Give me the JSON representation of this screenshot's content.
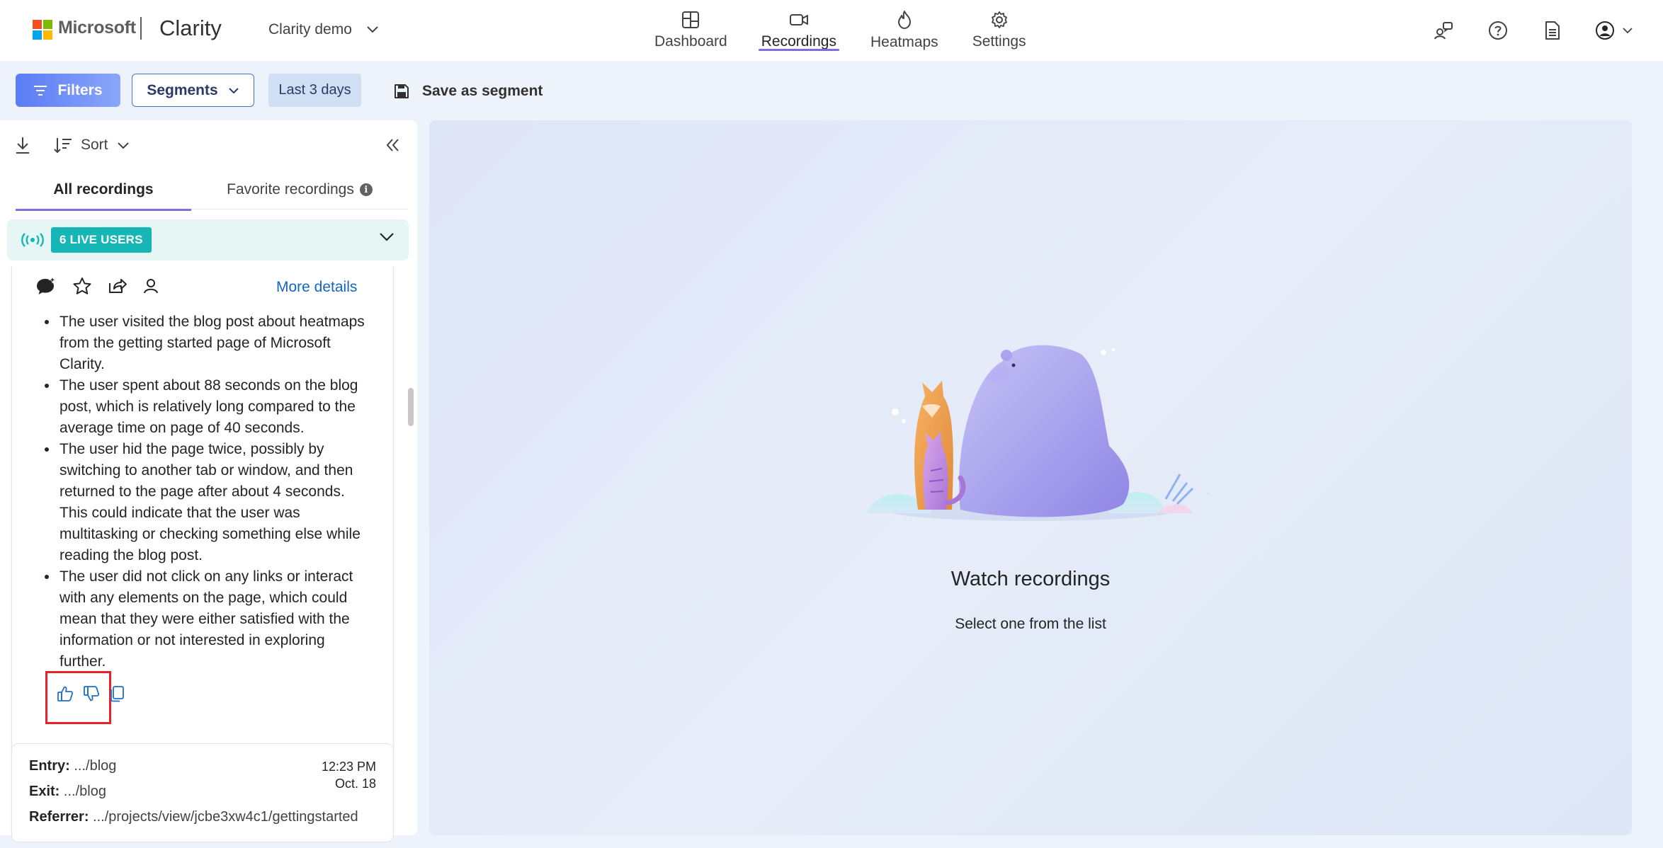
{
  "header": {
    "brand": "Microsoft",
    "app_name": "Clarity",
    "project": "Clarity demo",
    "nav": [
      {
        "label": "Dashboard",
        "icon": "dashboard-icon"
      },
      {
        "label": "Recordings",
        "icon": "video-camera-icon",
        "active": true
      },
      {
        "label": "Heatmaps",
        "icon": "flame-icon"
      },
      {
        "label": "Settings",
        "icon": "gear-icon"
      }
    ],
    "right_icons": [
      "people-chat-icon",
      "help-icon",
      "document-icon",
      "account-icon"
    ]
  },
  "filterbar": {
    "filters_label": "Filters",
    "segments_label": "Segments",
    "date_range": "Last 3 days",
    "save_label": "Save as segment"
  },
  "left_panel": {
    "sort_label": "Sort",
    "tabs": {
      "all": "All recordings",
      "favorite": "Favorite recordings"
    },
    "live_badge": "6 LIVE USERS",
    "card": {
      "more_details": "More details",
      "summary": [
        "The user visited the blog post about heatmaps from the getting started page of Microsoft Clarity.",
        "The user spent about 88 seconds on the blog post, which is relatively long compared to the average time on page of 40 seconds.",
        "The user hid the page twice, possibly by switching to another tab or window, and then returned to the page after about 4 seconds. This could indicate that the user was multitasking or checking something else while reading the blog post.",
        "The user did not click on any links or interact with any elements on the page, which could mean that they were either satisfied with the information or not interested in exploring further."
      ]
    },
    "recording": {
      "entry_label": "Entry:",
      "entry_value": ".../blog",
      "exit_label": "Exit:",
      "exit_value": ".../blog",
      "referrer_label": "Referrer:",
      "referrer_value": ".../projects/view/jcbe3xw4c1/gettingstarted",
      "time": "12:23 PM",
      "date": "Oct. 18"
    }
  },
  "right_panel": {
    "title": "Watch recordings",
    "subtitle": "Select one from the list"
  },
  "colors": {
    "accent": "#7c6fe0",
    "primary_button": "#5b7cf5",
    "live_badge": "#17b6b6",
    "link": "#1565c0",
    "highlight_box": "#e8202a"
  }
}
